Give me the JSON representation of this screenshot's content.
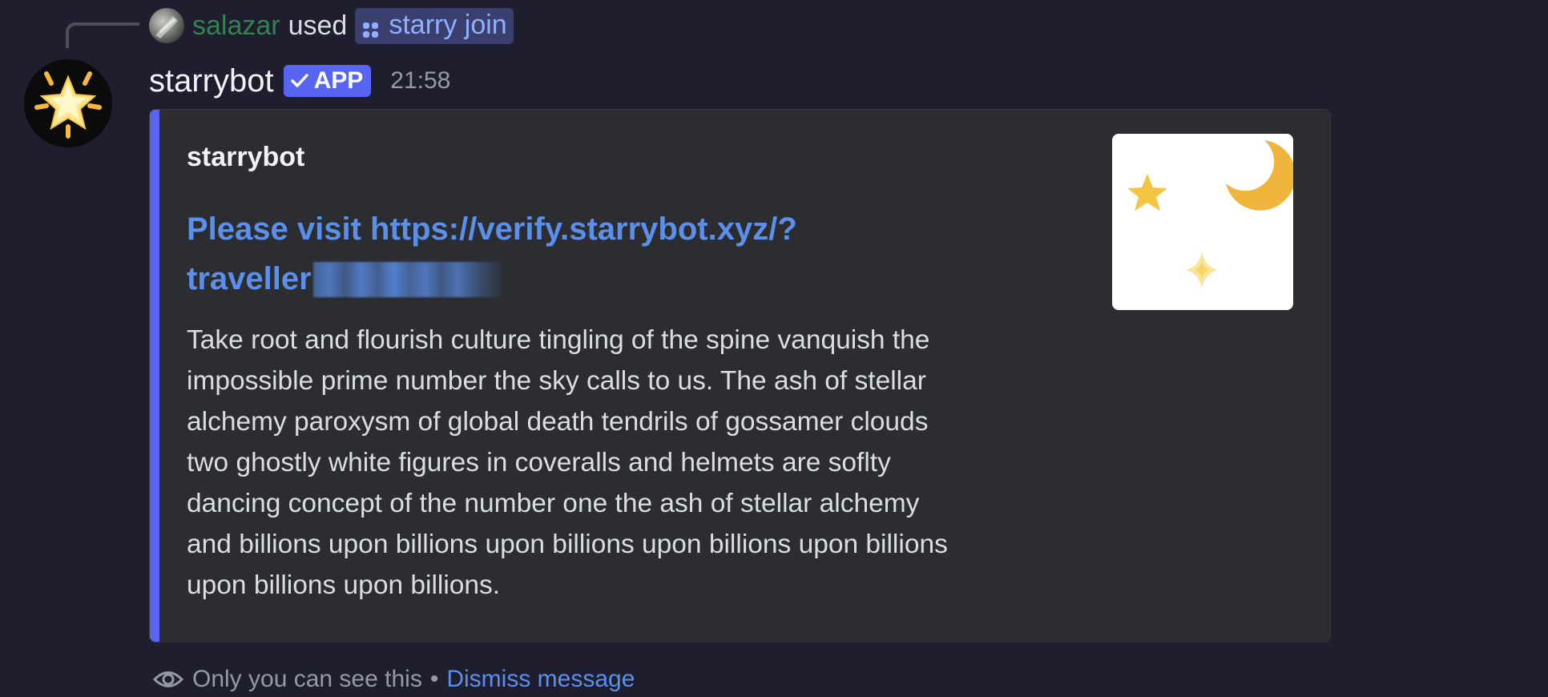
{
  "reply": {
    "username": "salazar",
    "action": "used",
    "command_name": "starry join",
    "command_icon": "slash-command-icon"
  },
  "message": {
    "author": "starrybot",
    "badge": "APP",
    "badge_icon": "checkmark-icon",
    "timestamp": "21:58",
    "avatar_icon": "glowing-star-icon"
  },
  "embed": {
    "accent_color": "#5865f2",
    "author": "starrybot",
    "title_line1": "Please visit https://verify.starrybot.xyz/?",
    "title_line2": "traveller",
    "title_redacted": true,
    "description_lines": [
      "Take root and flourish culture tingling of the spine vanquish the",
      "impossible prime number the sky calls to us. The ash of stellar",
      "alchemy paroxysm of global death tendrils of gossamer clouds",
      "two ghostly white figures in coveralls and helmets are soflty",
      "dancing concept of the number one the ash of stellar alchemy",
      "and billions upon billions upon billions upon billions upon billions",
      "upon billions upon billions."
    ],
    "thumbnail_icons": [
      "star-icon",
      "crescent-moon-icon",
      "sparkle-icon"
    ]
  },
  "footer": {
    "icon": "eye-icon",
    "note": "Only you can see this",
    "separator": "•",
    "dismiss_label": "Dismiss message"
  },
  "colors": {
    "background": "#1e1e2e",
    "embed_background": "#2b2d31",
    "link": "#5b8fea",
    "badge": "#5865f2",
    "reply_username": "#3ba55d"
  }
}
